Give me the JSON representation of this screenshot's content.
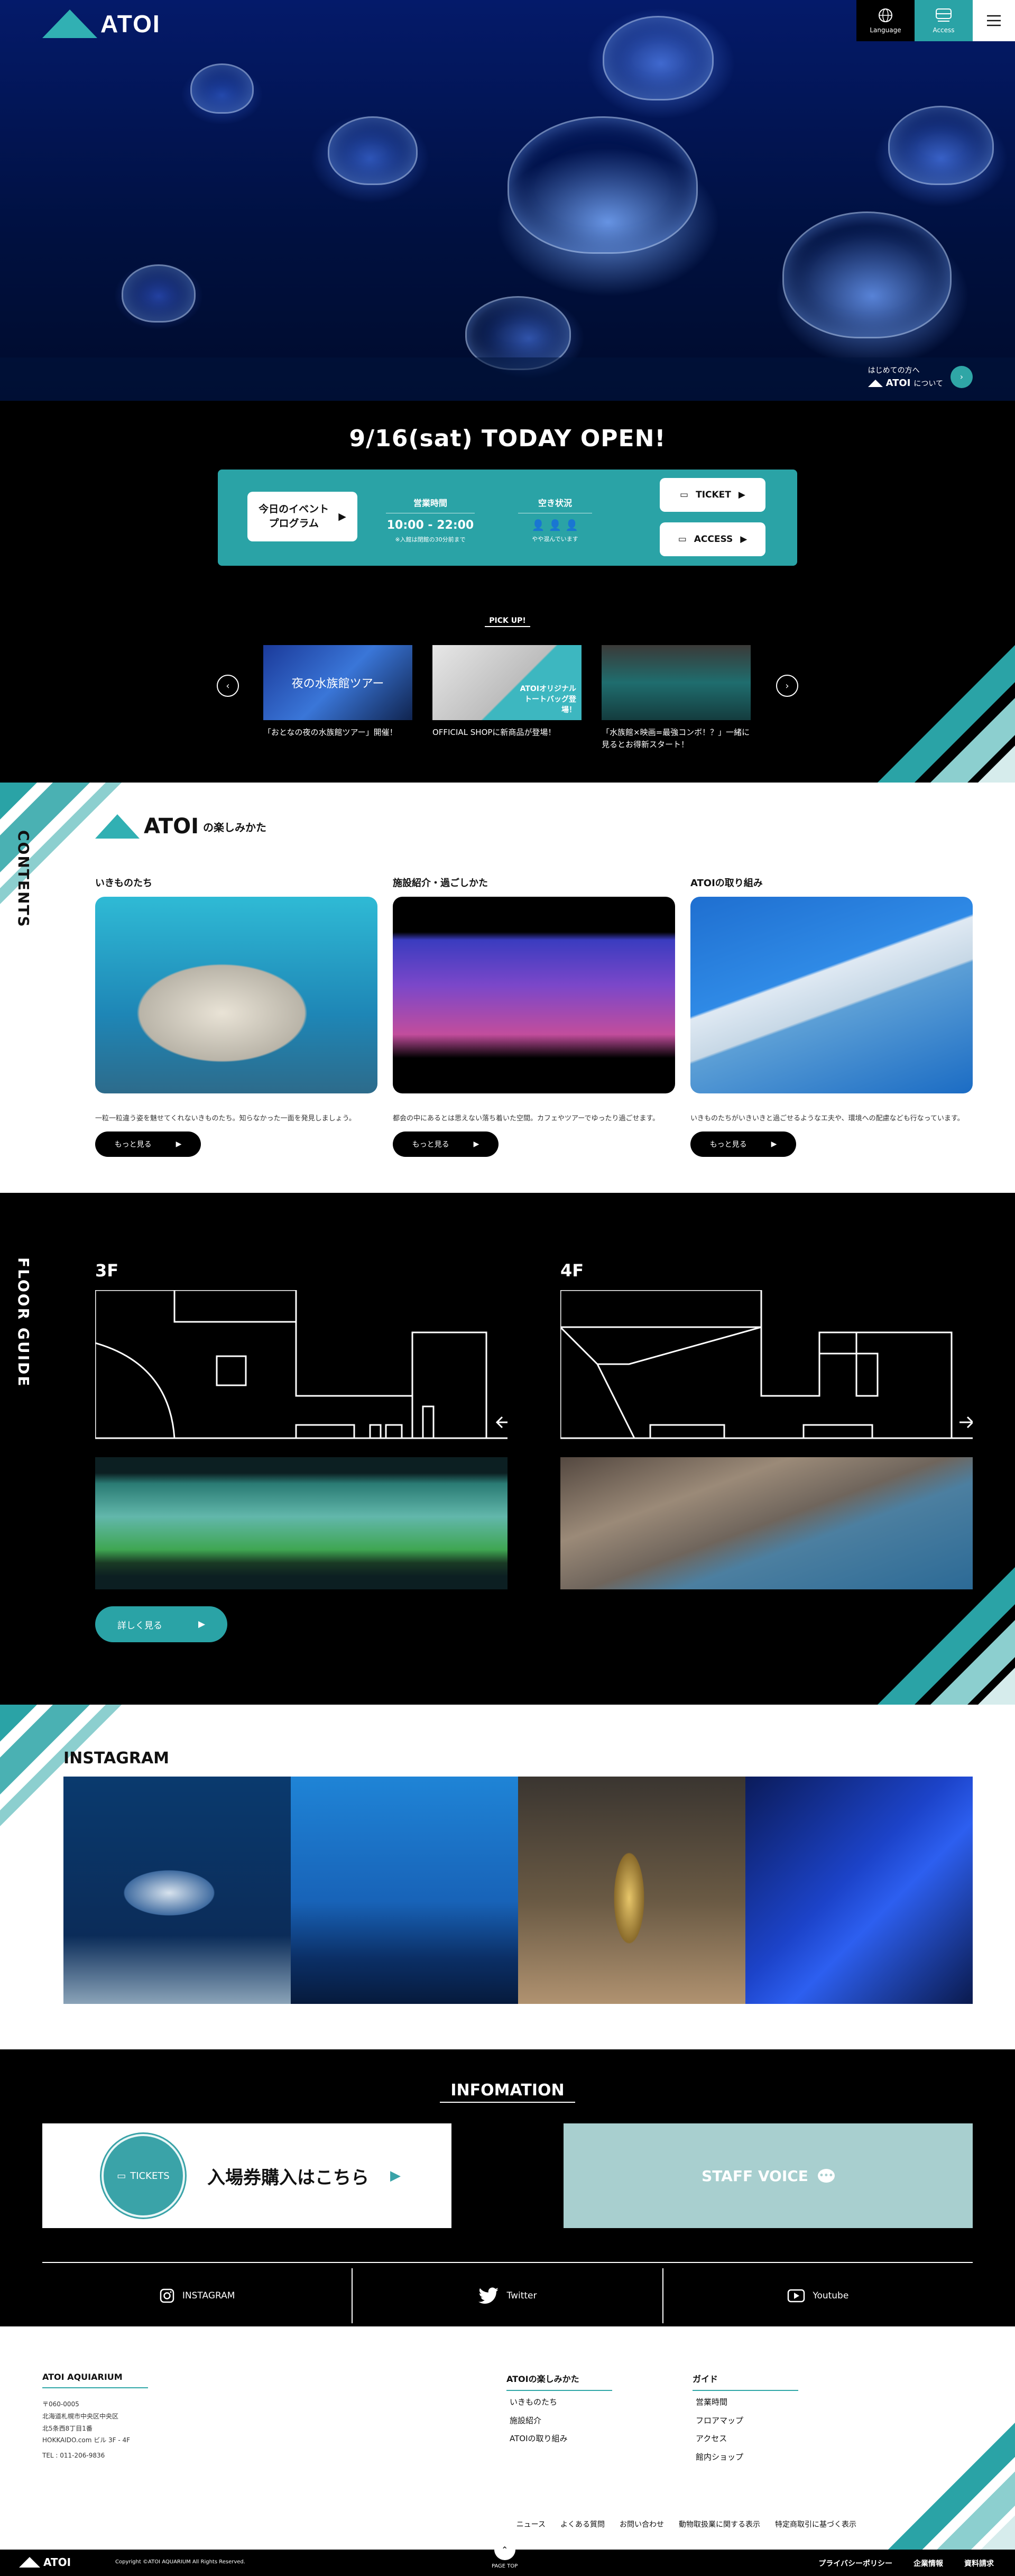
{
  "header": {
    "logo_text": "ATOI",
    "language_label": "Language",
    "access_label": "Access"
  },
  "hero": {
    "about_prefix": "はじめての方へ",
    "about_logo": "ATOI",
    "about_suffix": "について"
  },
  "today": {
    "title": "9/16(sat) TODAY OPEN!",
    "event_button": "今日のイベント\nプログラム",
    "hours_label": "営業時間",
    "hours_value": "10:00 - 22:00",
    "hours_note": "※入館は閉館の30分前まで",
    "status_label": "空き状況",
    "status_note": "やや混んでいます",
    "ticket_label": "TICKET",
    "access_label": "ACCESS"
  },
  "pickup": {
    "label": "PICK UP!",
    "items": [
      {
        "caption": "「おとなの夜の水族館ツアー」開催！",
        "image_text": "夜の水族館ツアー"
      },
      {
        "caption": "OFFICIAL SHOPに新商品が登場！",
        "image_text": "ATOIオリジナル トートバッグ登場！"
      },
      {
        "caption": "「水族館×映画=最強コンボ！？」一緒に見るとお得新スタート！",
        "image_text": ""
      }
    ]
  },
  "contents": {
    "vertical_label": "CONTENTS",
    "title_logo": "ATOI",
    "title_suffix": "の楽しみかた",
    "cards": [
      {
        "label": "いきものたち",
        "text": "一粒一粒違う姿を魅せてくれないきものたち。知らなかった一面を発見しましょう。",
        "button": "もっと見る"
      },
      {
        "label": "施設紹介・過ごしかた",
        "text": "都会の中にあるとは思えない落ち着いた空間。カフェやツアーでゆったり過ごせます。",
        "button": "もっと見る"
      },
      {
        "label": "ATOIの取り組み",
        "text": "いきものたちがいきいきと過ごせるようなエ夫や、環境への配慮なども行なっています。",
        "button": "もっと見る"
      }
    ]
  },
  "floor": {
    "vertical_label": "FLOOR GUIDE",
    "floors": [
      "3F",
      "4F"
    ],
    "detail_button": "詳しく見る"
  },
  "instagram": {
    "title": "INSTAGRAM"
  },
  "info": {
    "title": "INFOMATION",
    "ticket_badge": "TICKETS",
    "ticket_text": "入場券購入はこちら",
    "staff_voice": "STAFF VOICE",
    "social": [
      "INSTAGRAM",
      "Twitter",
      "Youtube"
    ]
  },
  "footer": {
    "org": "ATOI AQUIARIUM",
    "address": [
      "〒060-0005",
      "北海道札幌市中央区中央区",
      "北5条西8丁目1番",
      "HOKKAIDO.com ビル 3F - 4F",
      "TEL : 011-206-9836"
    ],
    "col1_head": "ATOIの楽しみかた",
    "col1_links": [
      "いきものたち",
      "施設紹介",
      "ATOIの取り組み"
    ],
    "col2_head": "ガイド",
    "col2_links": [
      "営業時間",
      "フロアマップ",
      "アクセス",
      "館内ショップ"
    ],
    "bottom_links": [
      "ニュース",
      "よくある質問",
      "お問い合わせ",
      "動物取扱業に関する表示",
      "特定商取引に基づく表示"
    ],
    "copyright": "Copyright ©ATOI AQUARIUM All Rights Reserved.",
    "page_top": "PAGE TOP",
    "legal_links": [
      "プライバシーポリシー",
      "企業情報",
      "資料請求"
    ],
    "logo_text": "ATOI"
  },
  "colors": {
    "accent": "#2aa3a6",
    "staff": "#a8cfcf",
    "hero": "#041a6a"
  }
}
